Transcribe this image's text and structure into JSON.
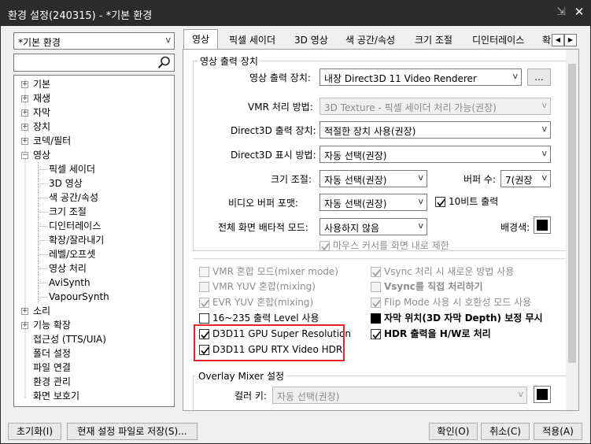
{
  "window": {
    "title": "환경 설정(240315) - *기본 환경",
    "pin_glyph": "⇲",
    "close_glyph": "✕"
  },
  "left": {
    "profile": "*기본 환경",
    "search_placeholder": "",
    "tree": [
      {
        "label": "기본",
        "expander": "+"
      },
      {
        "label": "재생",
        "expander": "+"
      },
      {
        "label": "자막",
        "expander": "+"
      },
      {
        "label": "장치",
        "expander": "+"
      },
      {
        "label": "코덱/필터",
        "expander": "+"
      },
      {
        "label": "영상",
        "expander": "−"
      },
      {
        "label": "픽셀 세이더"
      },
      {
        "label": "3D 영상"
      },
      {
        "label": "색 공간/속성"
      },
      {
        "label": "크기 조절"
      },
      {
        "label": "디인터레이스"
      },
      {
        "label": "확장/잘라내기"
      },
      {
        "label": "레벨/오프셋"
      },
      {
        "label": "영상 처리"
      },
      {
        "label": "AviSynth"
      },
      {
        "label": "VapourSynth"
      },
      {
        "label": "소리",
        "expander": "+"
      },
      {
        "label": "기능 확장",
        "expander": "+"
      },
      {
        "label": "접근성 (TTS/UIA)"
      },
      {
        "label": "폴더 설정"
      },
      {
        "label": "파일 연결"
      },
      {
        "label": "환경 관리"
      },
      {
        "label": "화면 보호기"
      }
    ]
  },
  "tabs": [
    "영상",
    "픽셀 세이더",
    "3D 영상",
    "색 공간/속성",
    "크기 조절",
    "디인터레이스",
    "확"
  ],
  "tab_scroll": {
    "left": "◀",
    "right": "▶"
  },
  "output": {
    "group_title": "영상 출력 장치",
    "device_label": "영상 출력 장치:",
    "device_value": "내장 Direct3D 11 Video Renderer",
    "more_button": "...",
    "vmr_label": "VMR 처리 방법:",
    "vmr_value": "3D Texture - 픽셀 세이더 처리 가능(권장)",
    "d3d_out_label": "Direct3D 출력 장치:",
    "d3d_out_value": "적절한 장치 사용(권장)",
    "d3d_disp_label": "Direct3D 표시 방법:",
    "d3d_disp_value": "자동 선택(권장)",
    "resize_label": "크기 조절:",
    "resize_value": "자동 선택(권장)",
    "buffer_label": "버퍼 수:",
    "buffer_value": "7(권장",
    "vbuf_label": "비디오 버퍼 포맷:",
    "vbuf_value": "자동 선택(권장)",
    "tenbit": "10비트 출력",
    "exclusive_label": "전체 화면 배타적 모드:",
    "exclusive_value": "사용하지 않음",
    "bgcolor_label": "배경색:",
    "mouse_cursor": "마우스 커서를 화면 내로 제한"
  },
  "checks": {
    "vmr_mix": "VMR 혼합 모드(mixer mode)",
    "vmr_yuv": "VMR YUV 혼합(mixing)",
    "evr_yuv": "EVR YUV 혼합(mixing)",
    "level": "16~235 출력 Level 사용",
    "super_res": "D3D11 GPU Super Resolution",
    "rtx_hdr": "D3D11 GPU RTX Video HDR",
    "vsync_new": "Vsync 처리 시 새로운 방법 사용",
    "vsync_direct": "Vsync를 직접 처리하기",
    "flip": "Flip Mode 사용 시 호환성 모드 사용",
    "subtitle_3d": "자막 위치(3D 자막 Depth) 보정 무시",
    "hdr_hw": "HDR 출력을 H/W로 처리"
  },
  "overlay": {
    "group_title": "Overlay Mixer 설정",
    "color_key_label": "컬러 키:",
    "color_key_value": "자동 선택(권장)"
  },
  "buttons": {
    "reset": "초기화(I)",
    "save_current": "현재 설정 파일로 저장(S)...",
    "ok": "확인(O)",
    "cancel": "취소(C)",
    "apply": "적용(A)"
  },
  "colors": {
    "highlight": "#e8232b",
    "titlebar": "#2b2b2b",
    "background_color": "#000000"
  }
}
